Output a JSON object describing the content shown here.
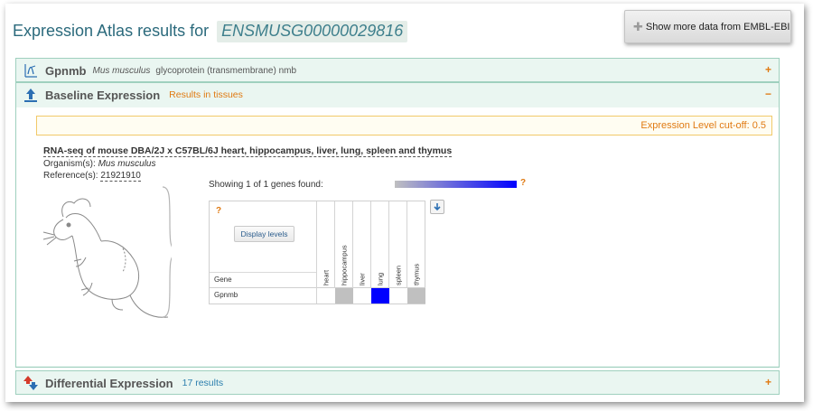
{
  "page": {
    "title": "Expression Atlas results for",
    "gene_id": "ENSMUSG00000029816",
    "more_button": "Show more data from EMBL-EBI",
    "more_button_icon": "plus-icon"
  },
  "gene_panel": {
    "name": "Gpnmb",
    "species": "Mus musculus",
    "description": "glycoprotein (transmembrane) nmb",
    "toggle": "+",
    "icon": "gene-icon"
  },
  "baseline": {
    "title": "Baseline Expression",
    "subtitle": "Results in tissues",
    "toggle": "−",
    "icon": "baseline-icon",
    "cutoff": "Expression Level cut-off: 0.5",
    "experiment_title": "RNA-seq of mouse DBA/2J x C57BL/6J heart, hippocampus, liver, lung, spleen and thymus",
    "organism_label": "Organism(s):",
    "organism_value": "Mus musculus",
    "reference_label": "Reference(s):",
    "reference_value": "21921910",
    "showing": "Showing 1 of 1 genes found:",
    "help_mark": "?",
    "display_levels": "Display levels",
    "gene_column": "Gene",
    "tissues": [
      "heart",
      "hippocampus",
      "liver",
      "lung",
      "spleen",
      "thymus"
    ],
    "rows": [
      {
        "gene": "Gpnmb",
        "cells": [
          "#ffffff",
          "#c0c0c0",
          "#ffffff",
          "#0000ff",
          "#ffffff",
          "#c0c0c0"
        ]
      }
    ],
    "scale_colors": [
      "#c0c0c0",
      "#0000ff"
    ]
  },
  "differential": {
    "title": "Differential Expression",
    "subtitle": "17 results",
    "toggle": "+",
    "icon": "differential-icon"
  }
}
